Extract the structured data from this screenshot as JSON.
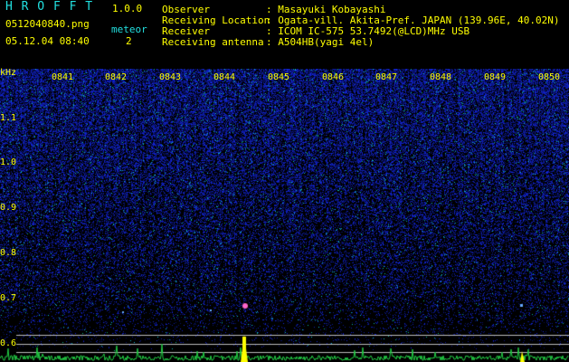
{
  "app": {
    "name": "H R O F F T",
    "version": "1.0.0",
    "filename": "0512040840.png",
    "datetime": "05.12.04 08:40",
    "meteor_label": "meteor",
    "meteor_count": "2"
  },
  "info": [
    {
      "label": "Observer",
      "value": ": Masayuki Kobayashi"
    },
    {
      "label": "Receiving Location",
      "value": ": Ogata-vill. Akita-Pref. JAPAN (139.96E, 40.02N)"
    },
    {
      "label": "Receiver",
      "value": ": ICOM IC-575 53.7492(@LCD)MHz USB"
    },
    {
      "label": "Receiving antenna",
      "value": ": A504HB(yagi 4el)"
    }
  ],
  "axis": {
    "y_unit": "kHz",
    "y_ticks": [
      "1.1",
      "1.0",
      "0.9",
      "0.8",
      "0.7",
      "0.6"
    ],
    "x_ticks": [
      "0841",
      "0842",
      "0843",
      "0844",
      "0845",
      "0846",
      "0847",
      "0848",
      "0849",
      "0850"
    ]
  },
  "colors": {
    "background": "#000000",
    "label": "#22e0e0",
    "tick": "#ffff00",
    "noise": "#1f2fd0",
    "meteor": "#ffff00"
  }
}
